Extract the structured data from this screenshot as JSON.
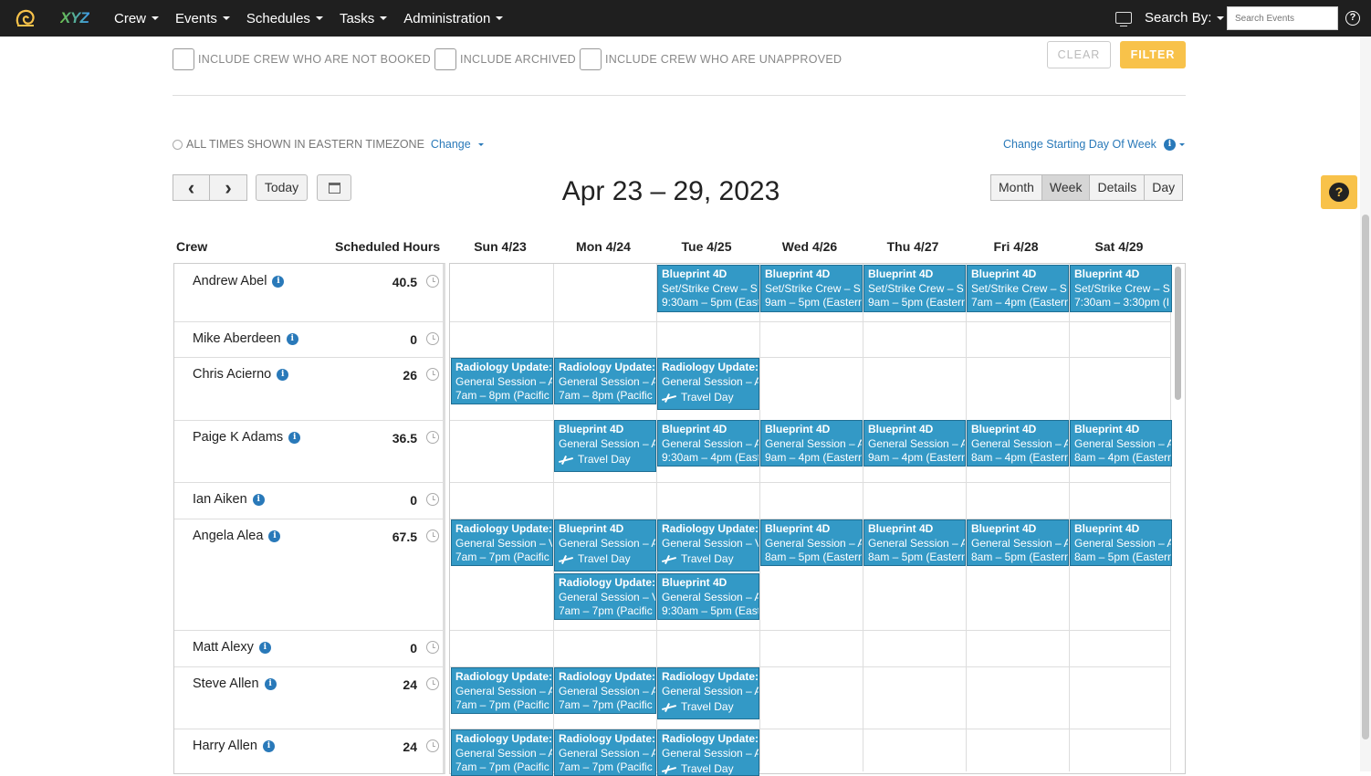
{
  "nav": {
    "logo": "XYZ",
    "menu": [
      {
        "label": "Crew"
      },
      {
        "label": "Events"
      },
      {
        "label": "Schedules"
      },
      {
        "label": "Tasks"
      },
      {
        "label": "Administration"
      }
    ],
    "search_by": "Search By:",
    "search_placeholder": "Search Events",
    "help": "?"
  },
  "filters": {
    "not_booked": "INCLUDE CREW WHO ARE NOT BOOKED",
    "archived": "INCLUDE ARCHIVED",
    "unapproved": "INCLUDE CREW WHO ARE UNAPPROVED",
    "clear": "CLEAR",
    "filter": "FILTER"
  },
  "timezone": {
    "text": "ALL TIMES SHOWN IN EASTERN TIMEZONE",
    "change": "Change",
    "start_day": "Change Starting Day Of Week"
  },
  "toolbar": {
    "prev": "‹",
    "next": "›",
    "today": "Today",
    "date_range": "Apr 23 – 29, 2023",
    "views": [
      "Month",
      "Week",
      "Details",
      "Day"
    ],
    "active_view": "Week"
  },
  "grid": {
    "crew_header": "Crew",
    "hours_header": "Scheduled Hours",
    "days": [
      "Sun 4/23",
      "Mon 4/24",
      "Tue 4/25",
      "Wed 4/26",
      "Thu 4/27",
      "Fri 4/28",
      "Sat 4/29"
    ],
    "crew": [
      {
        "name": "Andrew Abel",
        "hours": "40.5"
      },
      {
        "name": "Mike Aberdeen",
        "hours": "0"
      },
      {
        "name": "Chris Acierno",
        "hours": "26"
      },
      {
        "name": "Paige K Adams",
        "hours": "36.5"
      },
      {
        "name": "Ian Aiken",
        "hours": "0"
      },
      {
        "name": "Angela Alea",
        "hours": "67.5"
      },
      {
        "name": "Matt Alexy",
        "hours": "0"
      },
      {
        "name": "Steve Allen",
        "hours": "24"
      },
      {
        "name": "Harry Allen",
        "hours": "24"
      }
    ]
  },
  "events": [
    {
      "title": "Blueprint 4D",
      "line": "Set/Strike Crew – S",
      "time": "9:30am – 5pm (East"
    },
    {
      "title": "Blueprint 4D",
      "line": "Set/Strike Crew – S",
      "time": "9am – 5pm (Eastern"
    },
    {
      "title": "Blueprint 4D",
      "line": "Set/Strike Crew – S",
      "time": "9am – 5pm (Eastern"
    },
    {
      "title": "Blueprint 4D",
      "line": "Set/Strike Crew – S",
      "time": "7am – 4pm (Eastern"
    },
    {
      "title": "Blueprint 4D",
      "line": "Set/Strike Crew – S",
      "time": "7:30am – 3:30pm (I"
    },
    {
      "title": "Radiology Update:",
      "line": "General Session – A",
      "time": "7am – 8pm (Pacific"
    },
    {
      "title": "Radiology Update:",
      "line": "General Session – A",
      "time": "7am – 8pm (Pacific"
    },
    {
      "title": "Radiology Update:",
      "line": "General Session – A",
      "travel": "Travel Day"
    },
    {
      "title": "Blueprint 4D",
      "line": "General Session – A",
      "travel": "Travel Day"
    },
    {
      "title": "Blueprint 4D",
      "line": "General Session – A",
      "time": "9:30am – 4pm (East"
    },
    {
      "title": "Blueprint 4D",
      "line": "General Session – A",
      "time": "9am – 4pm (Eastern"
    },
    {
      "title": "Blueprint 4D",
      "line": "General Session – A",
      "time": "9am – 4pm (Eastern"
    },
    {
      "title": "Blueprint 4D",
      "line": "General Session – A",
      "time": "8am – 4pm (Eastern"
    },
    {
      "title": "Blueprint 4D",
      "line": "General Session – A",
      "time": "8am – 4pm (Eastern"
    },
    {
      "title": "Radiology Update:",
      "line": "General Session – V",
      "time": "7am – 7pm (Pacific"
    },
    {
      "title": "Blueprint 4D",
      "line": "General Session – A",
      "travel": "Travel Day"
    },
    {
      "title": "Radiology Update:",
      "line": "General Session – V",
      "travel": "Travel Day"
    },
    {
      "title": "Blueprint 4D",
      "line": "General Session – A",
      "time": "8am – 5pm (Eastern"
    },
    {
      "title": "Blueprint 4D",
      "line": "General Session – A",
      "time": "8am – 5pm (Eastern"
    },
    {
      "title": "Blueprint 4D",
      "line": "General Session – A",
      "time": "8am – 5pm (Eastern"
    },
    {
      "title": "Blueprint 4D",
      "line": "General Session – A",
      "time": "8am – 5pm (Eastern"
    },
    {
      "title": "Radiology Update:",
      "line": "General Session – V",
      "time": "7am – 7pm (Pacific"
    },
    {
      "title": "Blueprint 4D",
      "line": "General Session – A",
      "time": "9:30am – 5pm (East"
    },
    {
      "title": "Radiology Update:",
      "line": "General Session – A",
      "time": "7am – 7pm (Pacific"
    },
    {
      "title": "Radiology Update:",
      "line": "General Session – A",
      "time": "7am – 7pm (Pacific"
    },
    {
      "title": "Radiology Update:",
      "line": "General Session – A",
      "travel": "Travel Day"
    },
    {
      "title": "Radiology Update:",
      "line": "General Session – A",
      "time": "7am – 7pm (Pacific"
    },
    {
      "title": "Radiology Update:",
      "line": "General Session – A",
      "time": "7am – 7pm (Pacific"
    },
    {
      "title": "Radiology Update:",
      "line": "General Session – A",
      "travel": "Travel Day"
    }
  ]
}
